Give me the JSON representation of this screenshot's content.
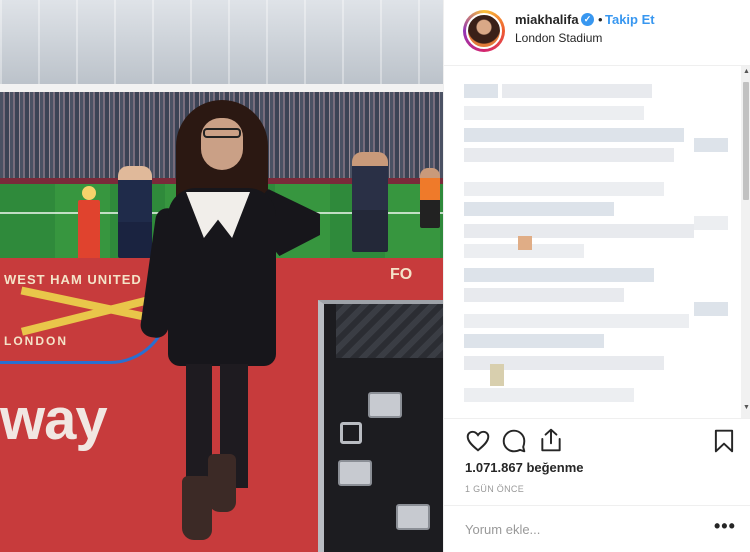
{
  "post": {
    "username": "miakhalifa",
    "verified_mark": "✓",
    "separator": "•",
    "follow_label": "Takip Et",
    "location": "London Stadium",
    "likes": "1.071.867 beğenme",
    "time_ago": "1 GÜN ÖNCE",
    "comment_placeholder": "Yorum ekle...",
    "more_label": "•••"
  },
  "photo": {
    "carpet_text": "way",
    "crest_line1": "WEST HAM UNITED",
    "crest_line2": "LONDON",
    "corner_text": "FO"
  },
  "icons": {
    "like": "heart-icon",
    "comment": "comment-icon",
    "share": "share-icon",
    "save": "bookmark-icon"
  },
  "colors": {
    "accent": "#3897f0",
    "text": "#262626",
    "muted": "#999999"
  }
}
